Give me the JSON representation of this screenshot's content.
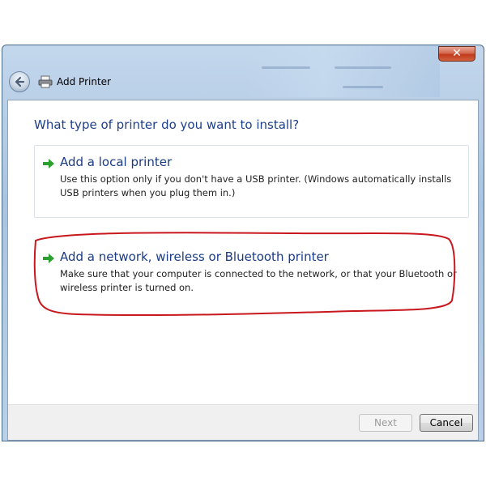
{
  "window": {
    "title": "Add Printer",
    "close_label": "✕"
  },
  "main": {
    "question": "What type of printer do you want to install?",
    "options": [
      {
        "title": "Add a local printer",
        "description": "Use this option only if you don't have a USB printer. (Windows automatically installs USB printers when you plug them in.)"
      },
      {
        "title": "Add a network, wireless or Bluetooth printer",
        "description": "Make sure that your computer is connected to the network, or that your Bluetooth or wireless printer is turned on."
      }
    ]
  },
  "footer": {
    "next_label": "Next",
    "cancel_label": "Cancel"
  },
  "colors": {
    "heading": "#1e3f8a",
    "arrow": "#2aa12f",
    "annotation": "#c8181e"
  },
  "icons": {
    "back": "back-arrow-icon",
    "app": "printer-icon",
    "option": "green-arrow-icon"
  }
}
